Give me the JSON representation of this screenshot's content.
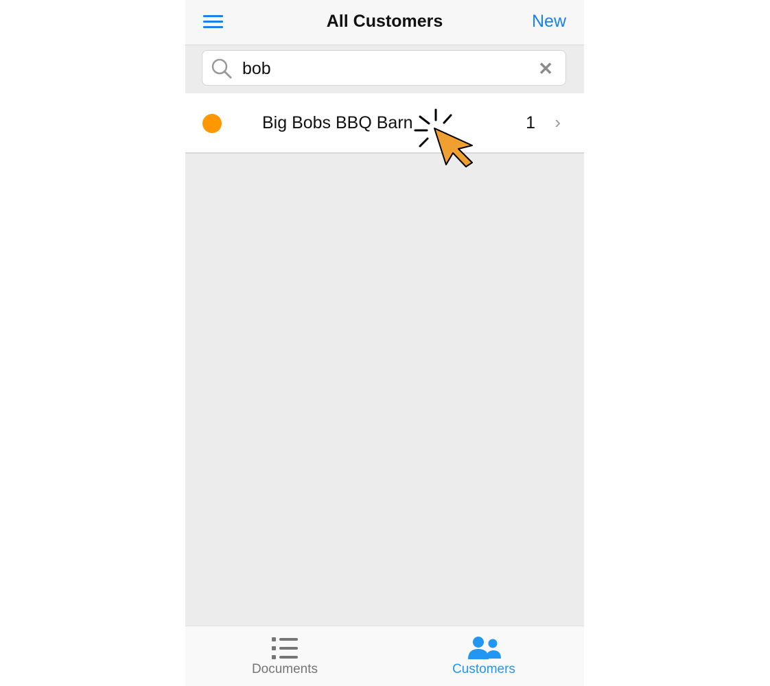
{
  "nav": {
    "title": "All Customers",
    "new_label": "New"
  },
  "search": {
    "value": "bob",
    "icon": "search-icon",
    "clear_icon": "close-icon"
  },
  "results": [
    {
      "name": "Big Bobs BBQ Barn",
      "count": "1",
      "status_color": "#ff9800"
    }
  ],
  "tabs": [
    {
      "label": "Documents",
      "icon": "list-icon",
      "active": false,
      "color": "#757575"
    },
    {
      "label": "Customers",
      "icon": "users-icon",
      "active": true,
      "color": "#2196f3"
    }
  ],
  "colors": {
    "accent": "#1a82f0"
  }
}
